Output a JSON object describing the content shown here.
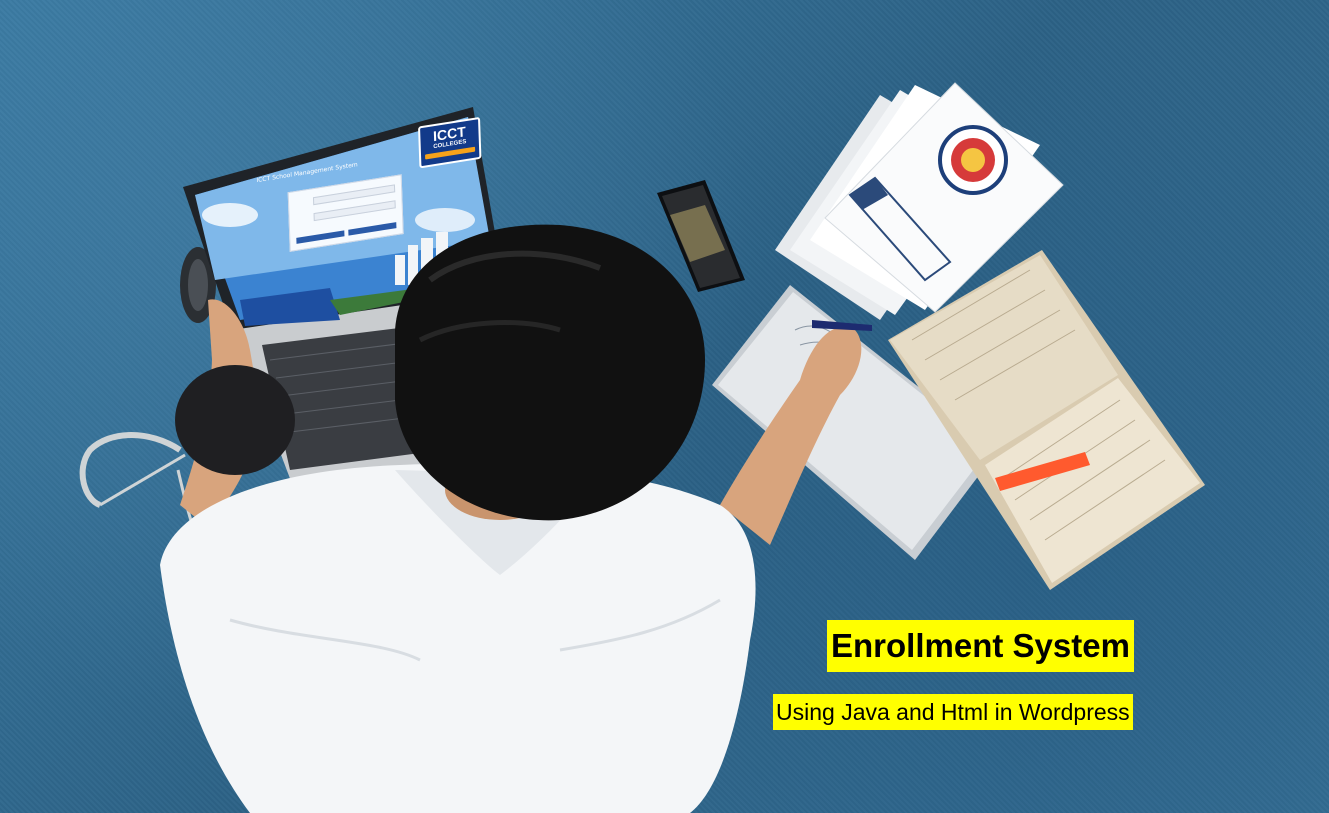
{
  "screen": {
    "header": "ICCT School Management System",
    "logo_line1": "ICCT",
    "logo_line2": "COLLEGES"
  },
  "overlay": {
    "title": "Enrollment System",
    "subtitle": "Using Java and Html in Wordpress"
  },
  "colors": {
    "carpet": "#2f6a8e",
    "highlight": "#ffff00",
    "shirt": "#f4f6f8",
    "hair": "#111111",
    "logo_blue": "#123a8a"
  }
}
